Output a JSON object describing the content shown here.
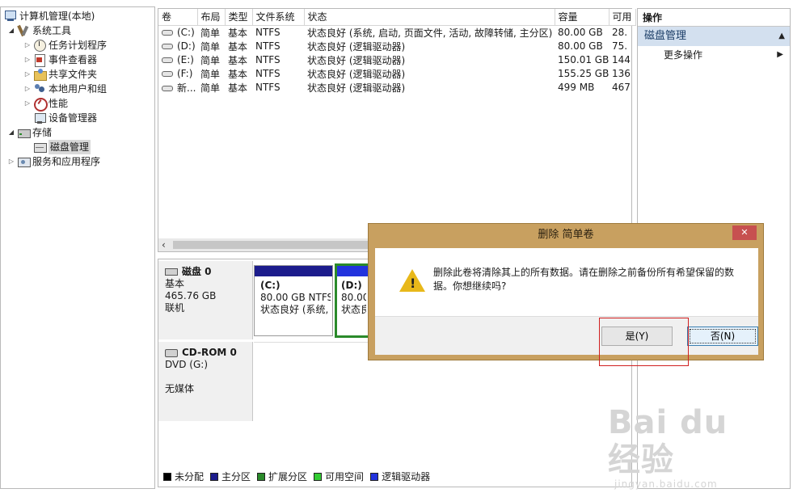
{
  "tree": {
    "root": "计算机管理(本地)",
    "system_tools": "系统工具",
    "task_scheduler": "任务计划程序",
    "event_viewer": "事件查看器",
    "shared_folders": "共享文件夹",
    "local_users": "本地用户和组",
    "performance": "性能",
    "device_manager": "设备管理器",
    "storage": "存储",
    "disk_management": "磁盘管理",
    "services": "服务和应用程序"
  },
  "volume_list": {
    "headers": [
      "卷",
      "布局",
      "类型",
      "文件系统",
      "状态",
      "容量",
      "可用"
    ],
    "rows": [
      [
        "(C:)",
        "简单",
        "基本",
        "NTFS",
        "状态良好 (系统, 启动, 页面文件, 活动, 故障转储, 主分区)",
        "80.00 GB",
        "28."
      ],
      [
        "(D:)",
        "简单",
        "基本",
        "NTFS",
        "状态良好 (逻辑驱动器)",
        "80.00 GB",
        "75."
      ],
      [
        "(E:)",
        "简单",
        "基本",
        "NTFS",
        "状态良好 (逻辑驱动器)",
        "150.01 GB",
        "144"
      ],
      [
        "(F:)",
        "简单",
        "基本",
        "NTFS",
        "状态良好 (逻辑驱动器)",
        "155.25 GB",
        "136"
      ],
      [
        "新...",
        "简单",
        "基本",
        "NTFS",
        "状态良好 (逻辑驱动器)",
        "499 MB",
        "467"
      ]
    ]
  },
  "disk_map": {
    "disk0": {
      "name": "磁盘 0",
      "type": "基本",
      "size": "465.76 GB",
      "status": "联机"
    },
    "partition_c": {
      "label": "(C:)",
      "size": "80.00 GB NTFS",
      "status": "状态良好 (系统,"
    },
    "partition_d": {
      "label": "(D:)",
      "size": "80.00",
      "status": "状态良"
    },
    "cdrom": {
      "name": "CD-ROM 0",
      "drive": "DVD (G:)",
      "status": "无媒体"
    },
    "legend": [
      {
        "label": "未分配",
        "color": "#000000"
      },
      {
        "label": "主分区",
        "color": "#1c1c8c"
      },
      {
        "label": "扩展分区",
        "color": "#2a8a2a"
      },
      {
        "label": "可用空间",
        "color": "#33cc33"
      },
      {
        "label": "逻辑驱动器",
        "color": "#2233dd"
      }
    ]
  },
  "actions": {
    "header": "操作",
    "section": "磁盘管理",
    "more": "更多操作"
  },
  "watermark": {
    "brand": "Bai du 经验",
    "url": "jingyan.baidu.com"
  },
  "dialog": {
    "title": "删除 简单卷",
    "close": "✕",
    "message": "删除此卷将清除其上的所有数据。请在删除之前备份所有希望保留的数据。你想继续吗?",
    "yes": "是(Y)",
    "no": "否(N)"
  },
  "colors": {
    "primary_partition": "#1c1c8c",
    "extended_partition": "#2a8a2a",
    "logical_drive": "#2233dd",
    "dialog_frame": "#c8a060",
    "action_section_bg": "#d3e0ef",
    "highlight_annotation": "#d02020"
  }
}
